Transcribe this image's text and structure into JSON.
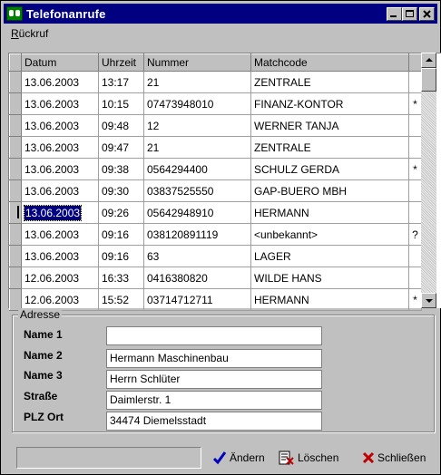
{
  "window": {
    "title": "Telefonanrufe",
    "minimize_label": "_",
    "maximize_label": "□",
    "close_label": "×"
  },
  "menu": {
    "rueckruf": "Rückruf",
    "rueckruf_first": "R",
    "rueckruf_rest": "ückruf"
  },
  "grid": {
    "columns": [
      "Datum",
      "Uhrzeit",
      "Nummer",
      "Matchcode"
    ],
    "rows": [
      {
        "datum": "13.06.2003",
        "uhrzeit": "13:17",
        "nummer": "21",
        "matchcode": "ZENTRALE",
        "flag": ""
      },
      {
        "datum": "13.06.2003",
        "uhrzeit": "10:15",
        "nummer": "07473948010",
        "matchcode": "FINANZ-KONTOR",
        "flag": "*"
      },
      {
        "datum": "13.06.2003",
        "uhrzeit": "09:48",
        "nummer": "12",
        "matchcode": "WERNER TANJA",
        "flag": ""
      },
      {
        "datum": "13.06.2003",
        "uhrzeit": "09:47",
        "nummer": "21",
        "matchcode": "ZENTRALE",
        "flag": ""
      },
      {
        "datum": "13.06.2003",
        "uhrzeit": "09:38",
        "nummer": "0564294400",
        "matchcode": "SCHULZ GERDA",
        "flag": "*"
      },
      {
        "datum": "13.06.2003",
        "uhrzeit": "09:30",
        "nummer": "03837525550",
        "matchcode": "GAP-BUERO MBH",
        "flag": ""
      },
      {
        "datum": "13.06.2003",
        "uhrzeit": "09:26",
        "nummer": "05642948910",
        "matchcode": "HERMANN",
        "flag": ""
      },
      {
        "datum": "13.06.2003",
        "uhrzeit": "09:16",
        "nummer": "038120891119",
        "matchcode": "<unbekannt>",
        "flag": "?"
      },
      {
        "datum": "13.06.2003",
        "uhrzeit": "09:16",
        "nummer": "63",
        "matchcode": "LAGER",
        "flag": ""
      },
      {
        "datum": "12.06.2003",
        "uhrzeit": "16:33",
        "nummer": "0416380820",
        "matchcode": "WILDE HANS",
        "flag": ""
      },
      {
        "datum": "12.06.2003",
        "uhrzeit": "15:52",
        "nummer": "03714712711",
        "matchcode": "HERMANN",
        "flag": "*"
      }
    ]
  },
  "address": {
    "legend": "Adresse",
    "name1_label": "Name 1",
    "name1_value": "",
    "name2_label": "Name 2",
    "name2_value": "Hermann Maschinenbau",
    "name3_label": "Name 3",
    "name3_value": "Herrn Schlüter",
    "strasse_label": "Straße",
    "strasse_value": "Daimlerstr. 1",
    "plzort_label": "PLZ Ort",
    "plzort_value": "34474 Diemelsstadt"
  },
  "buttons": {
    "aendern": "Ändern",
    "loeschen": "Löschen",
    "schliessen": "Schließen"
  },
  "icons": {
    "app": "phone-icon",
    "aendern": "checkmark-icon",
    "loeschen": "delete-document-icon",
    "schliessen": "x-icon"
  },
  "colors": {
    "titlebar": "#000080",
    "selection": "#000080",
    "checkmark": "#0000c0",
    "x_red": "#c00000"
  }
}
